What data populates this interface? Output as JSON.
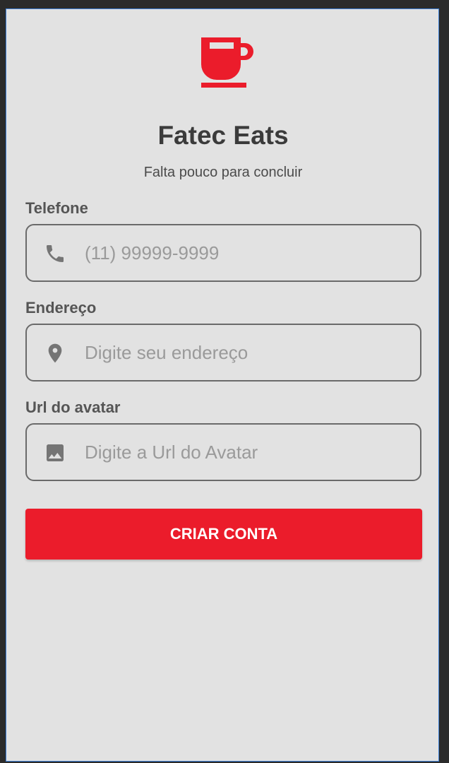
{
  "app": {
    "title": "Fatec Eats",
    "subtitle": "Falta pouco para concluir",
    "logo_icon": "coffee-cup-icon",
    "accent_color": "#eb1c2b"
  },
  "form": {
    "phone": {
      "label": "Telefone",
      "placeholder": "(11) 99999-9999",
      "value": "",
      "icon": "phone-icon"
    },
    "address": {
      "label": "Endereço",
      "placeholder": "Digite seu endereço",
      "value": "",
      "icon": "location-pin-icon"
    },
    "avatar_url": {
      "label": "Url do avatar",
      "placeholder": "Digite a Url do Avatar",
      "value": "",
      "icon": "image-icon"
    },
    "submit_label": "CRIAR CONTA"
  }
}
